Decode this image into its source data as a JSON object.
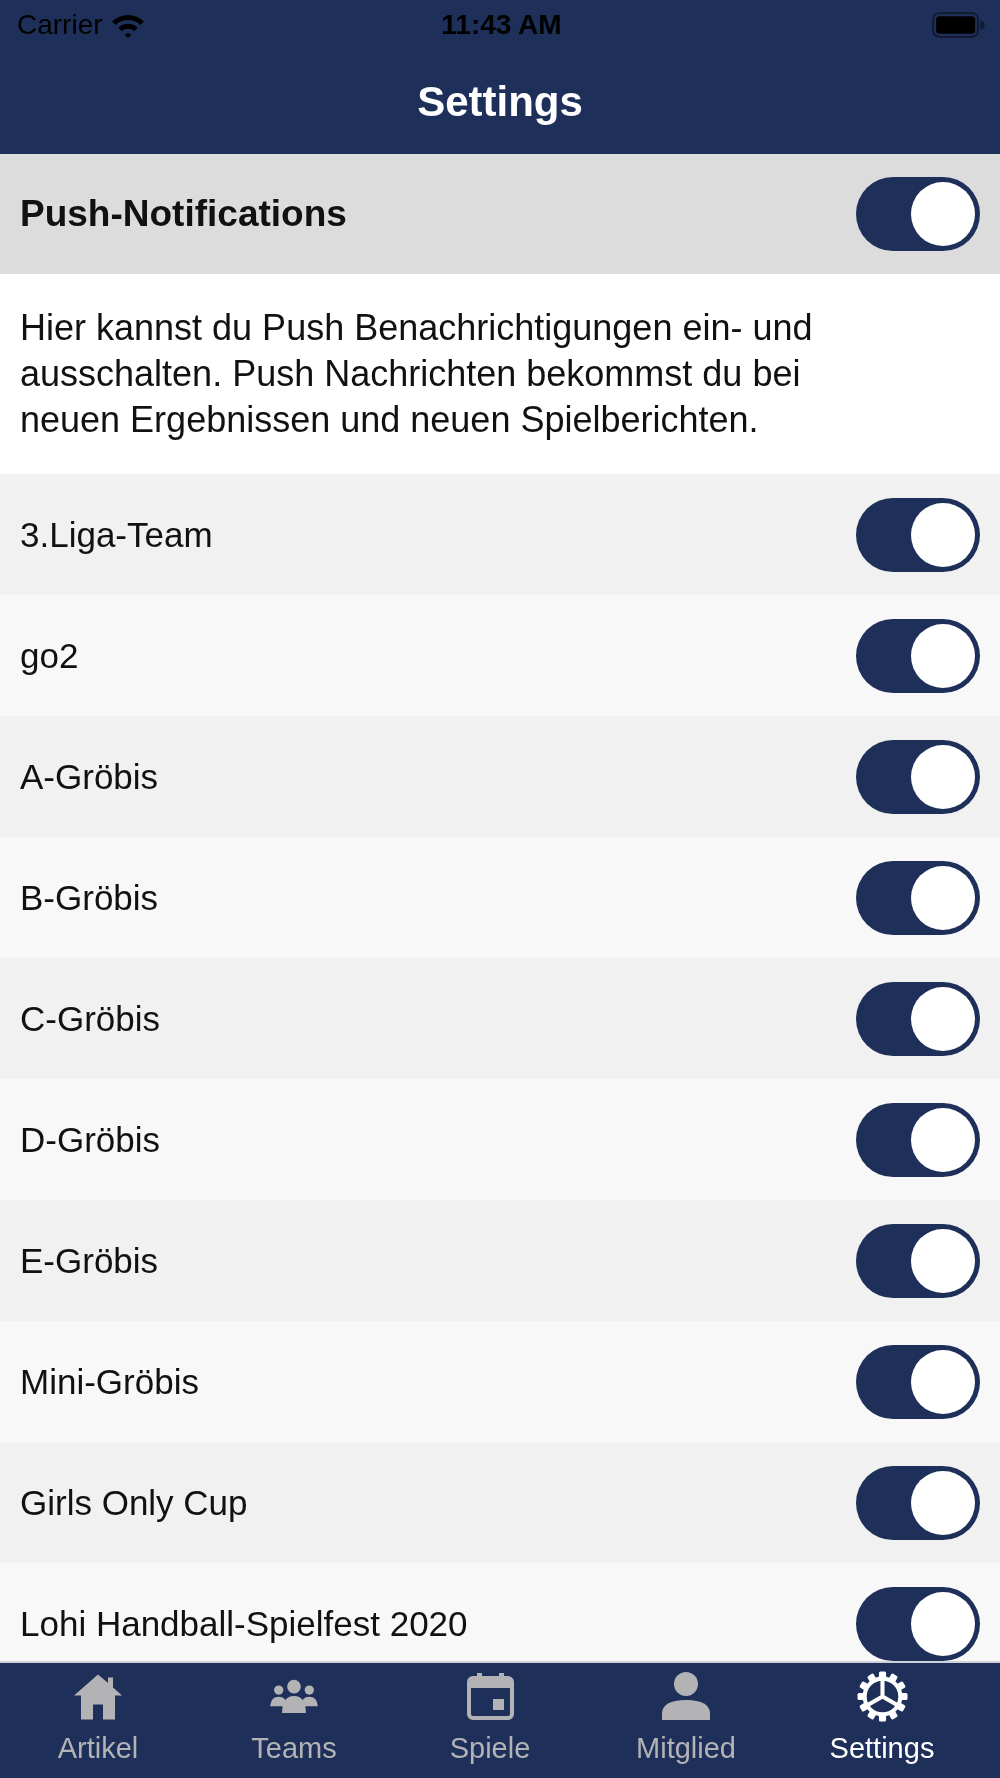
{
  "status_bar": {
    "carrier": "Carrier",
    "time": "11:43 AM"
  },
  "nav_bar": {
    "title": "Settings"
  },
  "push_notifications": {
    "label": "Push-Notifications",
    "on": true
  },
  "description": "Hier kannst du Push Benachrichtigungen ein- und ausschalten. Push Nachrichten bekommst du bei neuen Ergebnissen und neuen Spielberichten.",
  "teams": [
    {
      "name": "3.Liga-Team",
      "on": true
    },
    {
      "name": "go2",
      "on": true
    },
    {
      "name": "A-Gröbis",
      "on": true
    },
    {
      "name": "B-Gröbis",
      "on": true
    },
    {
      "name": "C-Gröbis",
      "on": true
    },
    {
      "name": "D-Gröbis",
      "on": true
    },
    {
      "name": "E-Gröbis",
      "on": true
    },
    {
      "name": "Mini-Gröbis",
      "on": true
    },
    {
      "name": "Girls Only Cup",
      "on": true
    },
    {
      "name": "Lohi Handball-Spielfest 2020",
      "on": true
    }
  ],
  "tab_bar": {
    "tabs": [
      {
        "label": "Artikel",
        "selected": false
      },
      {
        "label": "Teams",
        "selected": false
      },
      {
        "label": "Spiele",
        "selected": false
      },
      {
        "label": "Mitglied",
        "selected": false
      },
      {
        "label": "Settings",
        "selected": true
      }
    ]
  }
}
